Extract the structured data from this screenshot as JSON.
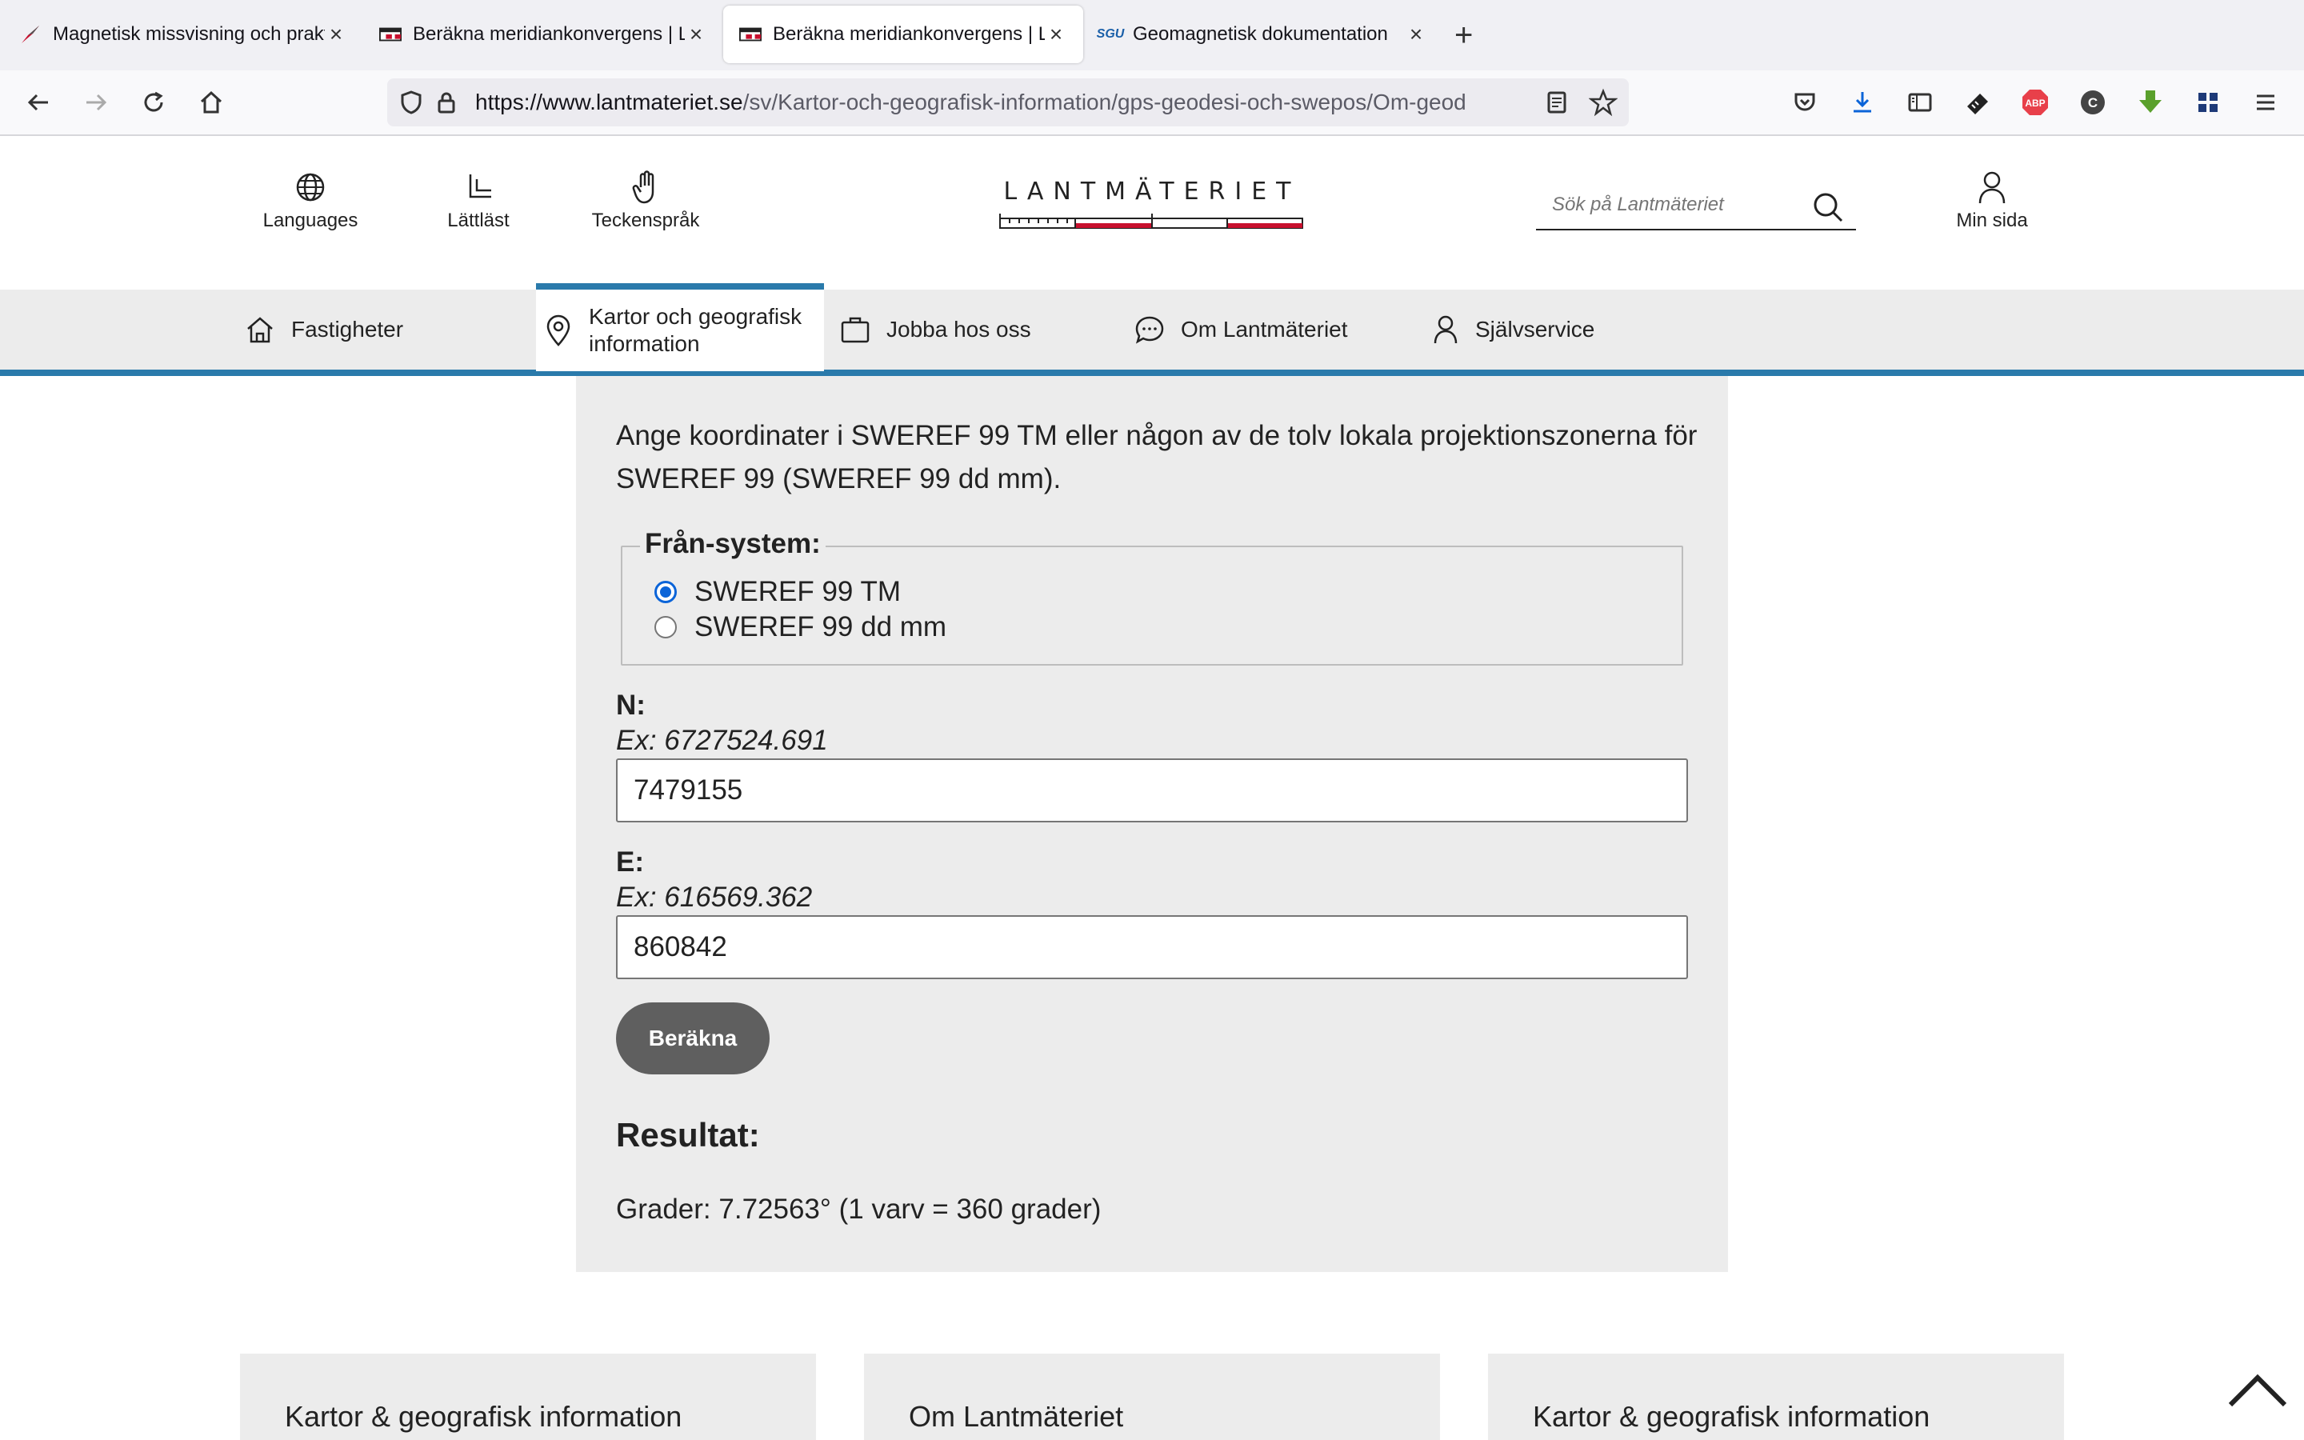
{
  "browser": {
    "tabs": [
      {
        "title": "Magnetisk missvisning och praktisk",
        "favicon": "compass-icon",
        "active": false
      },
      {
        "title": "Beräkna meridiankonvergens | L",
        "favicon": "lantmateriet-flag-icon",
        "active": false
      },
      {
        "title": "Beräkna meridiankonvergens | L",
        "favicon": "lantmateriet-flag-icon",
        "active": true
      },
      {
        "title": "Geomagnetisk dokumentation",
        "favicon": "sgu-icon",
        "active": false
      }
    ],
    "url_host": "https://www.lantmateriet.se",
    "url_path": "/sv/Kartor-och-geografisk-information/gps-geodesi-och-swepos/Om-geod",
    "sgu_favicon_text": "SGU",
    "abp_text": "ABP",
    "c_text": "C"
  },
  "header": {
    "languages": "Languages",
    "lattlast": "Lättläst",
    "teckensprak": "Teckenspråk",
    "logo_text": "LANTMÄTERIET",
    "search_placeholder": "Sök på Lantmäteriet",
    "min_sida": "Min sida",
    "accent_color": "#c8102e"
  },
  "mainnav": {
    "items": [
      {
        "label": "Fastigheter",
        "icon": "home-icon"
      },
      {
        "label": "Kartor och geografisk information",
        "icon": "location-pin-icon",
        "active": true
      },
      {
        "label": "Jobba hos oss",
        "icon": "briefcase-icon"
      },
      {
        "label": "Om Lantmäteriet",
        "icon": "chat-bubble-icon"
      },
      {
        "label": "Självservice",
        "icon": "user-icon"
      }
    ],
    "accent_color": "#2a7aab"
  },
  "form": {
    "intro": "Ange koordinater i SWEREF 99 TM eller någon av de tolv lokala projektionszonerna för SWEREF 99 (SWEREF 99 dd mm).",
    "legend": "Från-system:",
    "options": [
      "SWEREF 99 TM",
      "SWEREF 99 dd mm"
    ],
    "selected": "SWEREF 99 TM",
    "n_label": "N:",
    "n_example": "Ex: 6727524.691",
    "n_value": "7479155",
    "e_label": "E:",
    "e_example": "Ex: 616569.362",
    "e_value": "860842",
    "button": "Beräkna",
    "result_heading": "Resultat:",
    "result_text": "Grader: 7.72563°  (1 varv = 360 grader)"
  },
  "footer": {
    "cards": [
      "Kartor & geografisk information",
      "Om Lantmäteriet",
      "Kartor & geografisk information"
    ]
  }
}
